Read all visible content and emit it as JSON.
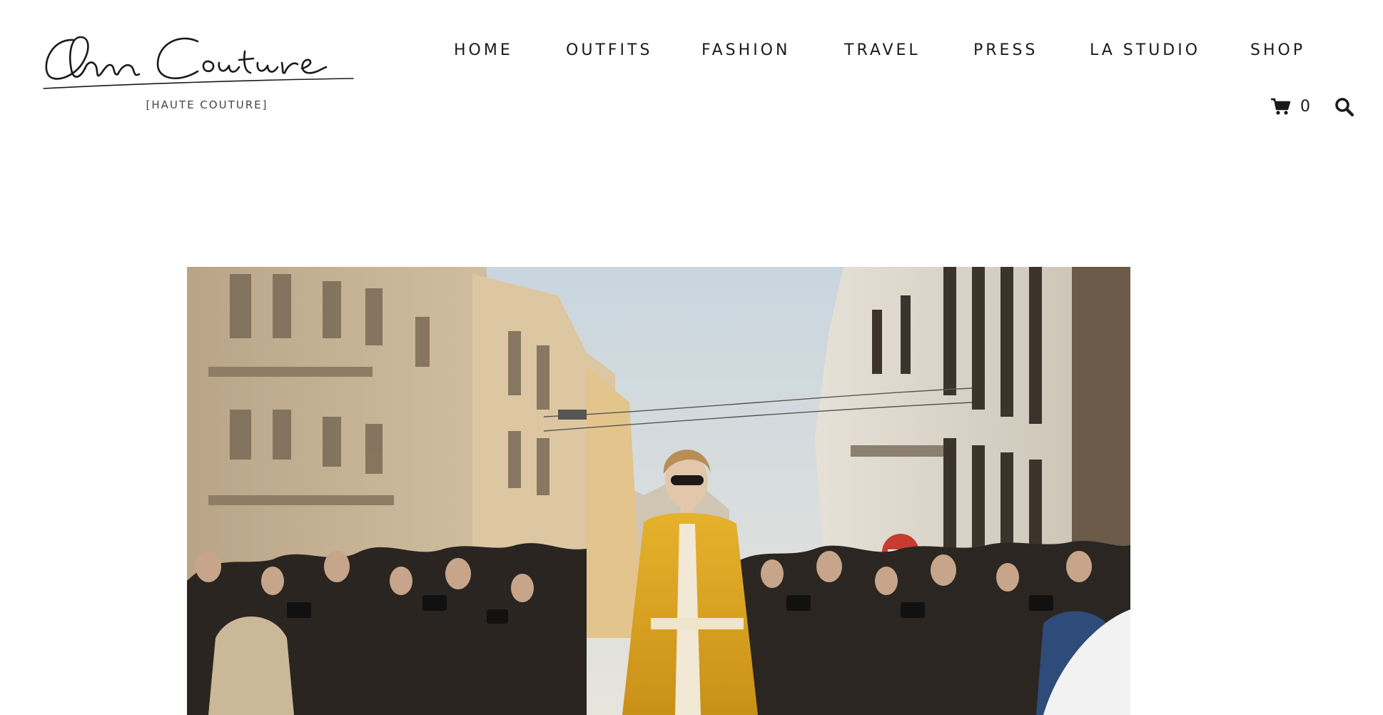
{
  "brand": {
    "logo_script": "Ana Couture",
    "tagline": "[HAUTE COUTURE]"
  },
  "nav": {
    "items": [
      {
        "label": "HOME"
      },
      {
        "label": "OUTFITS"
      },
      {
        "label": "FASHION"
      },
      {
        "label": "TRAVEL"
      },
      {
        "label": "PRESS"
      },
      {
        "label": "LA STUDIO"
      },
      {
        "label": "SHOP"
      }
    ]
  },
  "cart": {
    "icon": "shopping-cart-icon",
    "count": "0"
  },
  "search": {
    "icon": "search-icon"
  },
  "hero": {
    "subject": "street-style photograph"
  },
  "colors": {
    "text": "#1a1a1a",
    "background": "#ffffff",
    "coat_yellow": "#d9a424"
  }
}
